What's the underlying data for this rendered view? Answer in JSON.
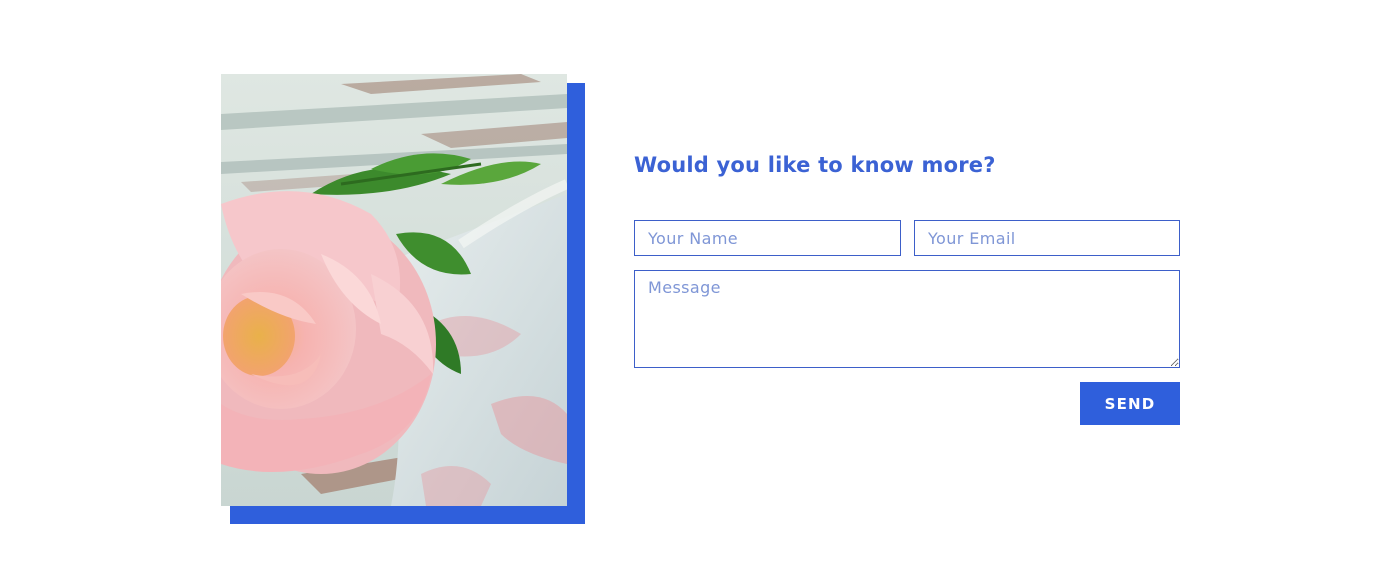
{
  "colors": {
    "accent": "#2f5fdc",
    "title": "#3b62d4",
    "field_border": "#3d5fc9",
    "placeholder": "#7f96d6"
  },
  "image": {
    "subject": "pink rose on wooden table"
  },
  "form": {
    "title": "Would you like to know more?",
    "name_placeholder": "Your Name",
    "name_value": "",
    "email_placeholder": "Your Email",
    "email_value": "",
    "message_placeholder": "Message",
    "message_value": "",
    "send_label": "SEND"
  }
}
